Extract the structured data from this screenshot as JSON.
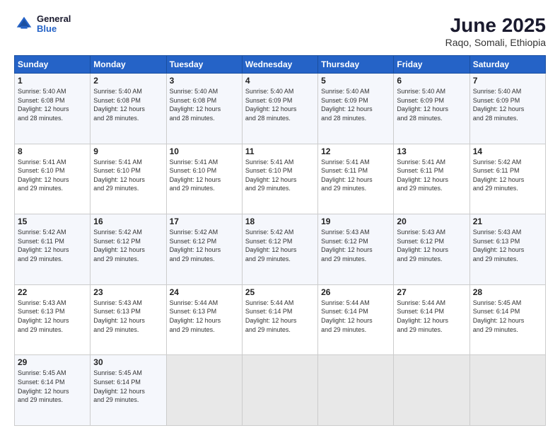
{
  "header": {
    "logo": {
      "general": "General",
      "blue": "Blue"
    },
    "title": "June 2025",
    "subtitle": "Raqo, Somali, Ethiopia"
  },
  "calendar": {
    "days_of_week": [
      "Sunday",
      "Monday",
      "Tuesday",
      "Wednesday",
      "Thursday",
      "Friday",
      "Saturday"
    ],
    "weeks": [
      [
        {
          "day": "",
          "info": ""
        },
        {
          "day": "2",
          "info": "Sunrise: 5:40 AM\nSunset: 6:08 PM\nDaylight: 12 hours\nand 28 minutes."
        },
        {
          "day": "3",
          "info": "Sunrise: 5:40 AM\nSunset: 6:08 PM\nDaylight: 12 hours\nand 28 minutes."
        },
        {
          "day": "4",
          "info": "Sunrise: 5:40 AM\nSunset: 6:09 PM\nDaylight: 12 hours\nand 28 minutes."
        },
        {
          "day": "5",
          "info": "Sunrise: 5:40 AM\nSunset: 6:09 PM\nDaylight: 12 hours\nand 28 minutes."
        },
        {
          "day": "6",
          "info": "Sunrise: 5:40 AM\nSunset: 6:09 PM\nDaylight: 12 hours\nand 28 minutes."
        },
        {
          "day": "7",
          "info": "Sunrise: 5:40 AM\nSunset: 6:09 PM\nDaylight: 12 hours\nand 28 minutes."
        }
      ],
      [
        {
          "day": "1",
          "info": "Sunrise: 5:40 AM\nSunset: 6:08 PM\nDaylight: 12 hours\nand 28 minutes.",
          "first": true
        },
        {
          "day": "9",
          "info": "Sunrise: 5:41 AM\nSunset: 6:10 PM\nDaylight: 12 hours\nand 29 minutes."
        },
        {
          "day": "10",
          "info": "Sunrise: 5:41 AM\nSunset: 6:10 PM\nDaylight: 12 hours\nand 29 minutes."
        },
        {
          "day": "11",
          "info": "Sunrise: 5:41 AM\nSunset: 6:10 PM\nDaylight: 12 hours\nand 29 minutes."
        },
        {
          "day": "12",
          "info": "Sunrise: 5:41 AM\nSunset: 6:11 PM\nDaylight: 12 hours\nand 29 minutes."
        },
        {
          "day": "13",
          "info": "Sunrise: 5:41 AM\nSunset: 6:11 PM\nDaylight: 12 hours\nand 29 minutes."
        },
        {
          "day": "14",
          "info": "Sunrise: 5:42 AM\nSunset: 6:11 PM\nDaylight: 12 hours\nand 29 minutes."
        }
      ],
      [
        {
          "day": "8",
          "info": "Sunrise: 5:41 AM\nSunset: 6:10 PM\nDaylight: 12 hours\nand 29 minutes."
        },
        {
          "day": "16",
          "info": "Sunrise: 5:42 AM\nSunset: 6:12 PM\nDaylight: 12 hours\nand 29 minutes."
        },
        {
          "day": "17",
          "info": "Sunrise: 5:42 AM\nSunset: 6:12 PM\nDaylight: 12 hours\nand 29 minutes."
        },
        {
          "day": "18",
          "info": "Sunrise: 5:42 AM\nSunset: 6:12 PM\nDaylight: 12 hours\nand 29 minutes."
        },
        {
          "day": "19",
          "info": "Sunrise: 5:43 AM\nSunset: 6:12 PM\nDaylight: 12 hours\nand 29 minutes."
        },
        {
          "day": "20",
          "info": "Sunrise: 5:43 AM\nSunset: 6:12 PM\nDaylight: 12 hours\nand 29 minutes."
        },
        {
          "day": "21",
          "info": "Sunrise: 5:43 AM\nSunset: 6:13 PM\nDaylight: 12 hours\nand 29 minutes."
        }
      ],
      [
        {
          "day": "15",
          "info": "Sunrise: 5:42 AM\nSunset: 6:11 PM\nDaylight: 12 hours\nand 29 minutes."
        },
        {
          "day": "23",
          "info": "Sunrise: 5:43 AM\nSunset: 6:13 PM\nDaylight: 12 hours\nand 29 minutes."
        },
        {
          "day": "24",
          "info": "Sunrise: 5:44 AM\nSunset: 6:13 PM\nDaylight: 12 hours\nand 29 minutes."
        },
        {
          "day": "25",
          "info": "Sunrise: 5:44 AM\nSunset: 6:14 PM\nDaylight: 12 hours\nand 29 minutes."
        },
        {
          "day": "26",
          "info": "Sunrise: 5:44 AM\nSunset: 6:14 PM\nDaylight: 12 hours\nand 29 minutes."
        },
        {
          "day": "27",
          "info": "Sunrise: 5:44 AM\nSunset: 6:14 PM\nDaylight: 12 hours\nand 29 minutes."
        },
        {
          "day": "28",
          "info": "Sunrise: 5:45 AM\nSunset: 6:14 PM\nDaylight: 12 hours\nand 29 minutes."
        }
      ],
      [
        {
          "day": "22",
          "info": "Sunrise: 5:43 AM\nSunset: 6:13 PM\nDaylight: 12 hours\nand 29 minutes."
        },
        {
          "day": "30",
          "info": "Sunrise: 5:45 AM\nSunset: 6:14 PM\nDaylight: 12 hours\nand 29 minutes."
        },
        {
          "day": "",
          "info": ""
        },
        {
          "day": "",
          "info": ""
        },
        {
          "day": "",
          "info": ""
        },
        {
          "day": "",
          "info": ""
        },
        {
          "day": "",
          "info": ""
        }
      ],
      [
        {
          "day": "29",
          "info": "Sunrise: 5:45 AM\nSunset: 6:14 PM\nDaylight: 12 hours\nand 29 minutes."
        },
        {
          "day": "",
          "info": ""
        },
        {
          "day": "",
          "info": ""
        },
        {
          "day": "",
          "info": ""
        },
        {
          "day": "",
          "info": ""
        },
        {
          "day": "",
          "info": ""
        },
        {
          "day": "",
          "info": ""
        }
      ]
    ]
  }
}
